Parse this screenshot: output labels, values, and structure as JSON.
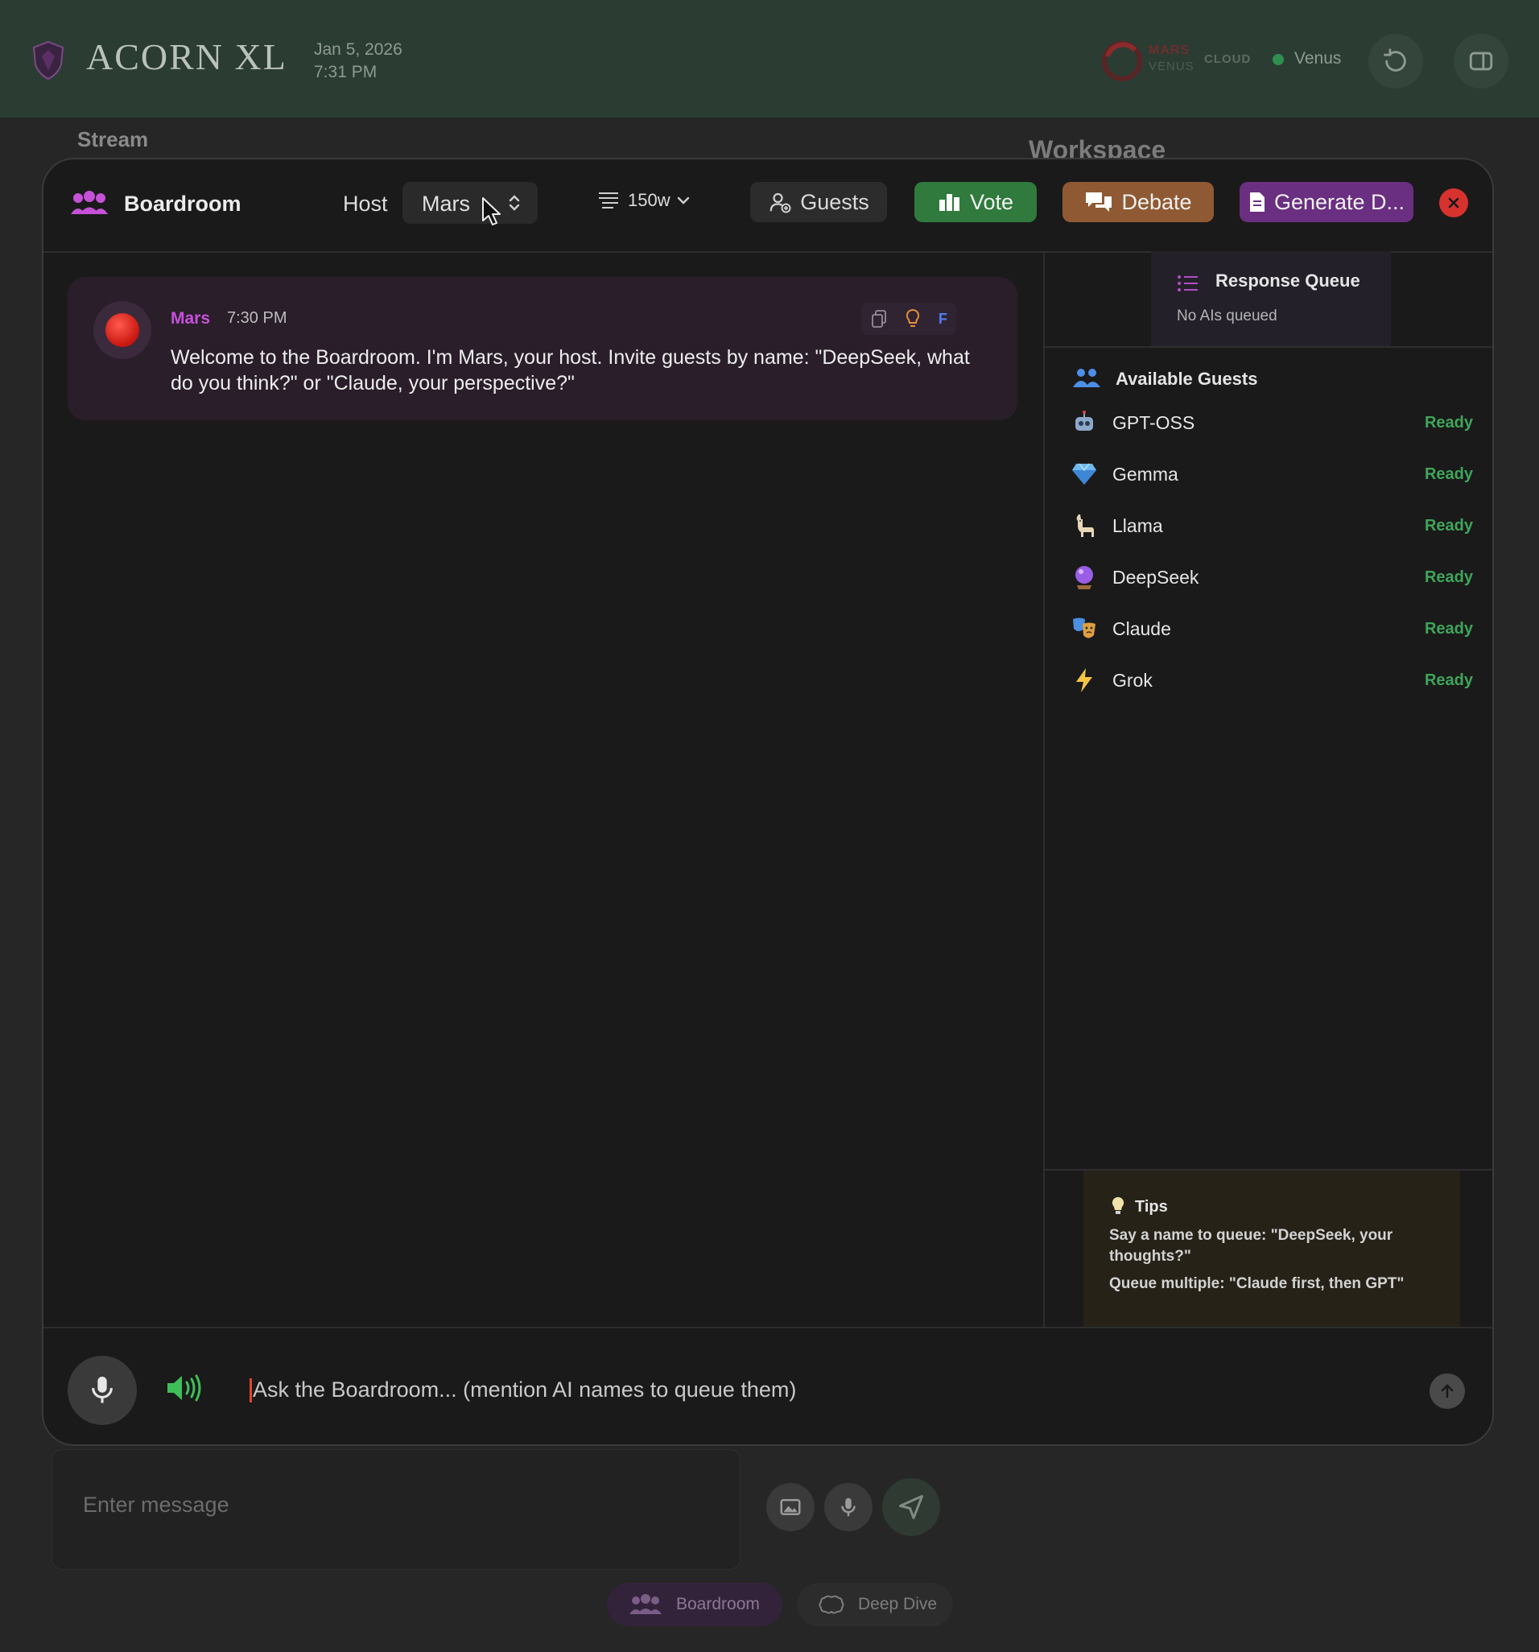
{
  "app": {
    "title": "ACORN XL",
    "date": "Jan 5, 2026",
    "time": "7:31 PM"
  },
  "cloud": {
    "mars_label": "MARS",
    "venus_label": "VENUS",
    "cloud_label": "CLOUD",
    "active_node": "Venus",
    "status_color": "#2f8f4e"
  },
  "background": {
    "stream_label": "Stream",
    "workspace_label": "Workspace"
  },
  "boardroom": {
    "title": "Boardroom",
    "host_label": "Host",
    "host_value": "Mars",
    "length_value": "150w",
    "buttons": {
      "guests": "Guests",
      "vote": "Vote",
      "debate": "Debate",
      "generate": "Generate D..."
    },
    "colors": {
      "vote": "#2f7a3c",
      "debate": "#8f5a33",
      "generate": "#6a2f80",
      "close": "#d8322e",
      "accent": "#c651d8"
    }
  },
  "message": {
    "author": "Mars",
    "time": "7:30 PM",
    "action_f": "F",
    "text": "Welcome to the Boardroom. I'm Mars, your host. Invite guests by name: \"DeepSeek, what do you think?\" or \"Claude, your perspective?\""
  },
  "queue": {
    "title": "Response Queue",
    "empty_text": "No AIs queued"
  },
  "guests": {
    "title": "Available Guests",
    "list": [
      {
        "name": "GPT-OSS",
        "status": "Ready",
        "icon": "robot-icon"
      },
      {
        "name": "Gemma",
        "status": "Ready",
        "icon": "gem-icon"
      },
      {
        "name": "Llama",
        "status": "Ready",
        "icon": "llama-icon"
      },
      {
        "name": "DeepSeek",
        "status": "Ready",
        "icon": "crystal-ball-icon"
      },
      {
        "name": "Claude",
        "status": "Ready",
        "icon": "theater-masks-icon"
      },
      {
        "name": "Grok",
        "status": "Ready",
        "icon": "lightning-icon"
      }
    ]
  },
  "tips": {
    "title": "Tips",
    "line1": "Say a name to queue: \"DeepSeek, your thoughts?\"",
    "line2": "Queue multiple: \"Claude first, then GPT\""
  },
  "input": {
    "placeholder": "Ask the Boardroom... (mention AI names to queue them)"
  },
  "underlying": {
    "message_placeholder": "Enter message",
    "modes": [
      "Boardroom",
      "Deep Dive"
    ]
  }
}
